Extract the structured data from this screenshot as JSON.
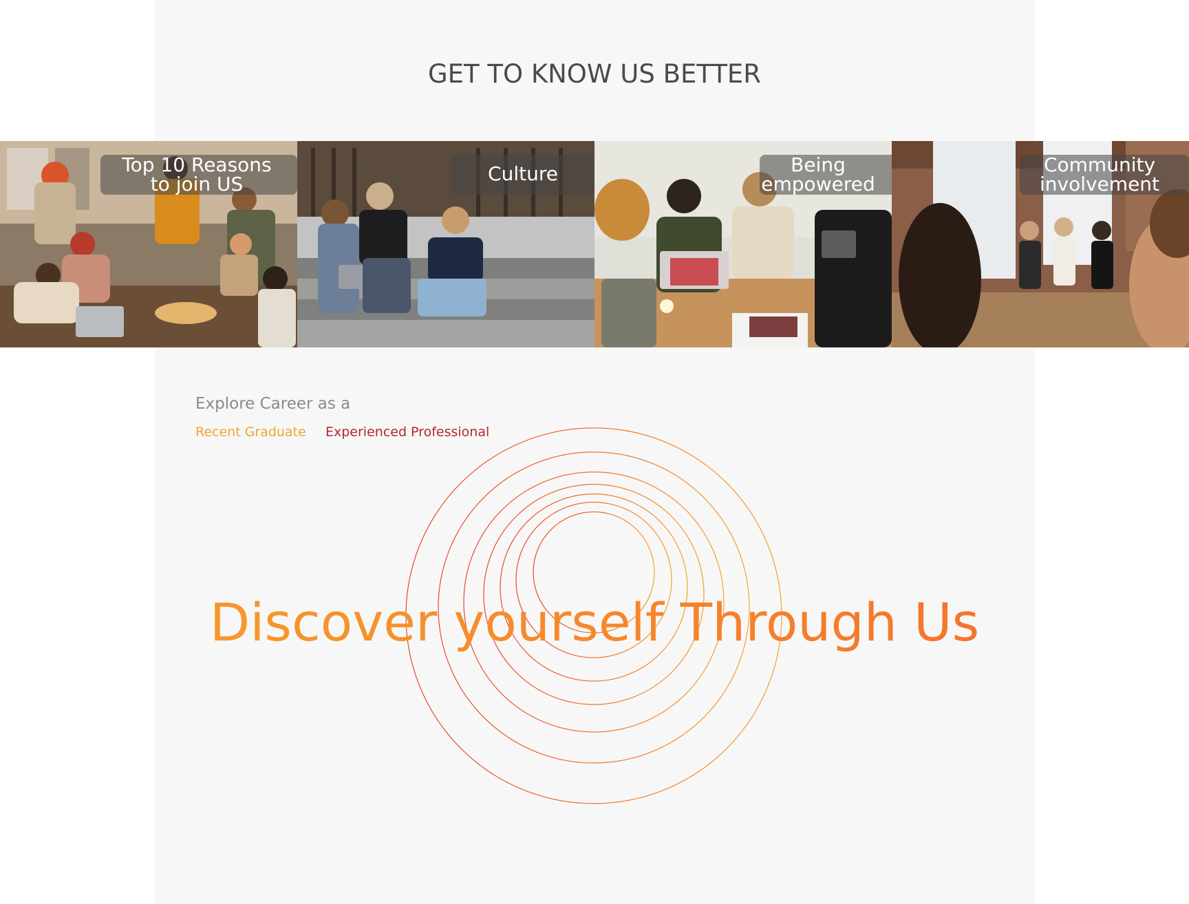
{
  "section": {
    "title": "GET TO KNOW US BETTER"
  },
  "tiles": [
    {
      "label": "Top 10 Reasons\nto join US",
      "photo": "group-of-friends-eating-pizza"
    },
    {
      "label": "Culture",
      "photo": "colleagues-sitting-on-steps"
    },
    {
      "label": "Being\nempowered",
      "photo": "team-meeting-at-desk"
    },
    {
      "label": "Community\ninvolvement",
      "photo": "women-seated-in-circle-meeting"
    }
  ],
  "career": {
    "explore_label": "Explore Career as a",
    "recent_graduate": "Recent Graduate",
    "experienced_professional": "Experienced Professional"
  },
  "hero": {
    "headline": "Discover yourself Through Us"
  },
  "colors": {
    "accent_yellow": "#f0a530",
    "accent_red": "#b2272c",
    "gradient_start": "#f7a12a",
    "gradient_end": "#f26a2d"
  }
}
